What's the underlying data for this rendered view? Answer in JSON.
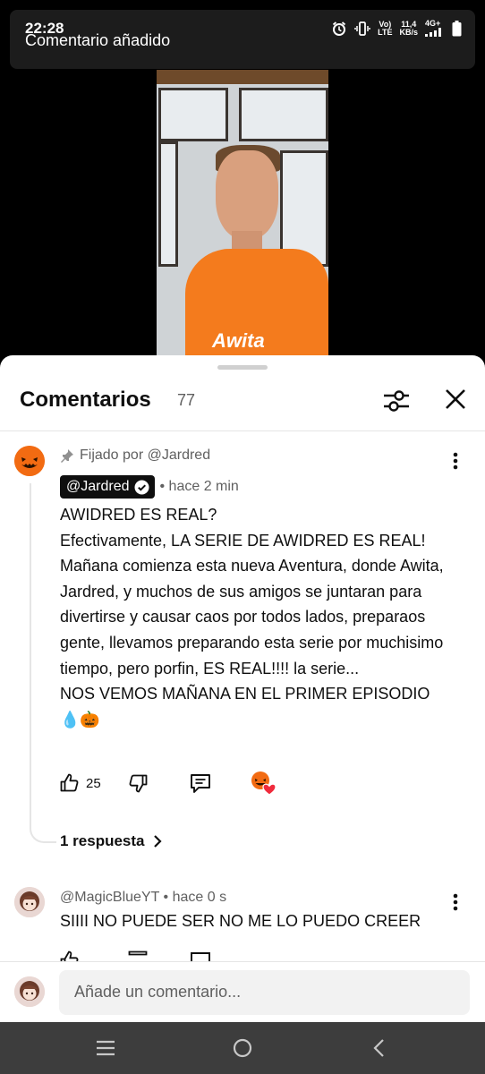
{
  "status_bar": {
    "time": "22:28",
    "volte_top": "Vo)",
    "volte_bottom": "LTE",
    "speed_top": "11,4",
    "speed_bottom": "KB/s",
    "network": "4G+"
  },
  "toast": {
    "text": "Comentario añadido"
  },
  "video": {
    "shirt_print": "Awita"
  },
  "sheet": {
    "title": "Comentarios",
    "count": "77"
  },
  "pinned_comment": {
    "pinned_label": "Fijado por @Jardred",
    "author": "@Jardred",
    "time": "• hace 2 min",
    "lines": [
      "AWIDRED ES REAL?",
      "Efectivamente, LA SERIE DE AWIDRED ES REAL! Mañana comienza esta nueva Aventura, donde Awita, Jardred, y muchos de sus amigos se juntaran para divertirse y causar caos por todos lados, preparaos gente, llevamos preparando esta serie por muchisimo tiempo, pero porfin, ES REAL!!!! la serie...",
      "NOS VEMOS MAÑANA EN EL PRIMER EPISODIO",
      "💧🎃"
    ],
    "likes": "25",
    "replies_label": "1 respuesta"
  },
  "second_comment": {
    "author_time": "@MagicBlueYT • hace 0 s",
    "text": "SIIII NO PUEDE SER NO ME LO PUEDO CREER"
  },
  "composer": {
    "placeholder": "Añade un comentario..."
  },
  "colors": {
    "accent_orange": "#f26b12",
    "text_primary": "#0f0f0f",
    "text_secondary": "#606060",
    "navbar": "#3d3d3d"
  }
}
